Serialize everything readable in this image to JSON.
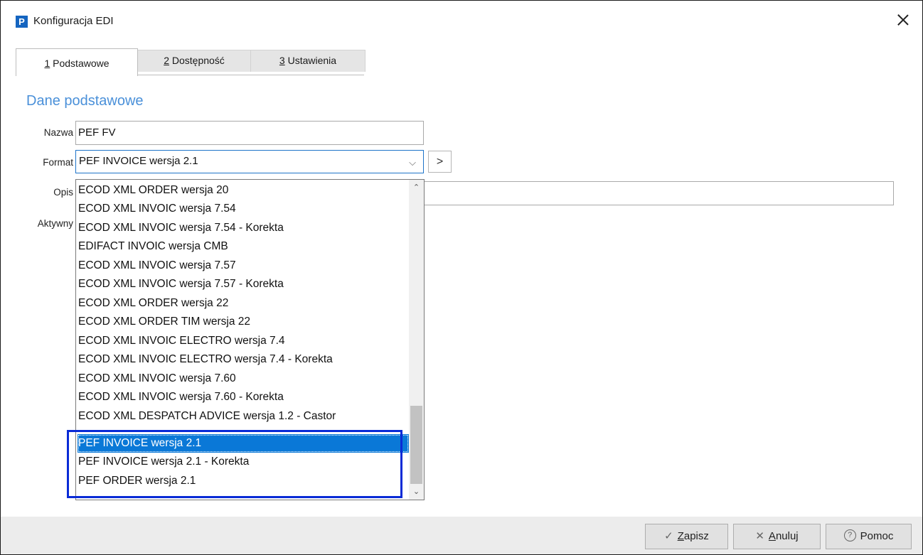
{
  "window": {
    "app_icon": "P",
    "title": "Konfiguracja EDI",
    "close_icon": "close-icon"
  },
  "tabs": [
    {
      "key": "1",
      "label": " Podstawowe",
      "active": true
    },
    {
      "key": "2",
      "label": " Dostępność",
      "active": false
    },
    {
      "key": "3",
      "label": " Ustawienia",
      "active": false
    }
  ],
  "section_title": "Dane podstawowe",
  "form": {
    "nazwa_label": "Nazwa",
    "nazwa_value": "PEF FV",
    "format_label": "Format",
    "format_value": "PEF INVOICE wersja 2.1",
    "format_arrow": "⌵",
    "nav_button": ">",
    "opis_label": "Opis",
    "aktywny_label": "Aktywny"
  },
  "dropdown": {
    "items": [
      "ECOD XML ORDER wersja 20",
      "ECOD XML INVOIC wersja 7.54",
      "ECOD XML INVOIC wersja 7.54 - Korekta",
      "EDIFACT INVOIC wersja CMB",
      "ECOD XML INVOIC wersja 7.57",
      "ECOD XML INVOIC wersja 7.57 - Korekta",
      "ECOD XML ORDER wersja 22",
      "ECOD XML ORDER TIM wersja 22",
      "ECOD XML INVOIC ELECTRO wersja 7.4",
      "ECOD XML INVOIC ELECTRO wersja 7.4 - Korekta",
      "ECOD XML INVOIC wersja 7.60",
      "ECOD XML INVOIC wersja 7.60 - Korekta",
      "ECOD XML DESPATCH ADVICE wersja 1.2 - Castor",
      "PEF INVOICE wersja 2.1",
      "PEF INVOICE wersja 2.1 - Korekta",
      "PEF ORDER wersja 2.1"
    ],
    "selected_item": "PEF INVOICE wersja 2.1",
    "scroll_up": "⌃",
    "scroll_down": "⌄"
  },
  "footer": {
    "save": {
      "icon": "✓",
      "underline": "Z",
      "rest": "apisz"
    },
    "cancel": {
      "icon": "✕",
      "underline": "A",
      "rest": "nuluj"
    },
    "help": {
      "icon": "?",
      "label": "Pomoc"
    }
  },
  "colors": {
    "accent": "#4a90d9",
    "selection": "#0a78d7",
    "highlight_border": "#0a2bd6",
    "focus_border": "#1e74c9"
  }
}
